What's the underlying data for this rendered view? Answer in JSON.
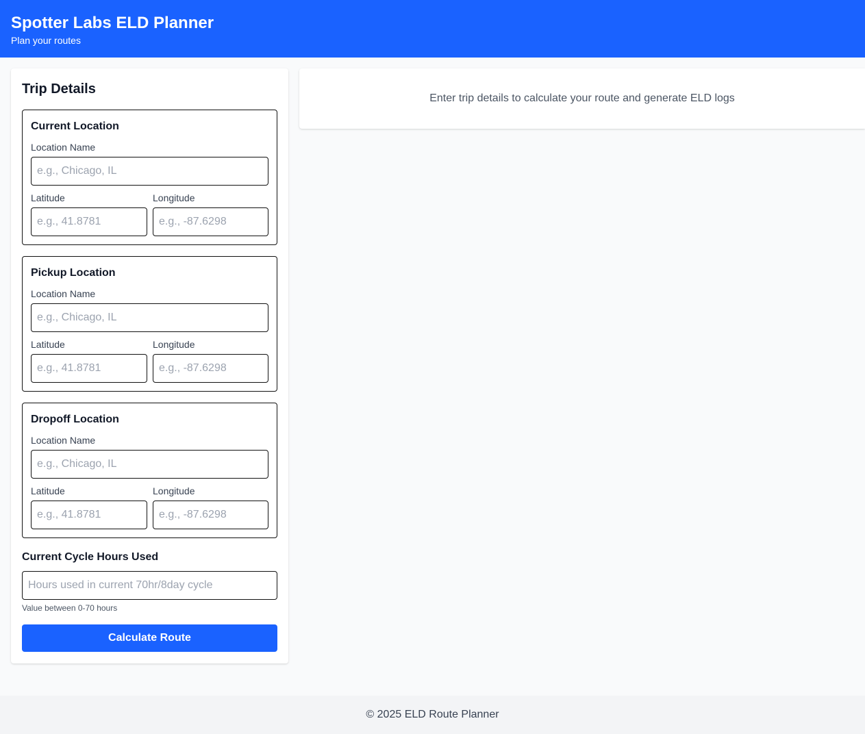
{
  "header": {
    "title": "Spotter Labs ELD Planner",
    "subtitle": "Plan your routes"
  },
  "form": {
    "title": "Trip Details",
    "sections": [
      {
        "title": "Current Location",
        "name_label": "Location Name",
        "name_placeholder": "e.g., Chicago, IL",
        "lat_label": "Latitude",
        "lat_placeholder": "e.g., 41.8781",
        "lng_label": "Longitude",
        "lng_placeholder": "e.g., -87.6298"
      },
      {
        "title": "Pickup Location",
        "name_label": "Location Name",
        "name_placeholder": "e.g., Chicago, IL",
        "lat_label": "Latitude",
        "lat_placeholder": "e.g., 41.8781",
        "lng_label": "Longitude",
        "lng_placeholder": "e.g., -87.6298"
      },
      {
        "title": "Dropoff Location",
        "name_label": "Location Name",
        "name_placeholder": "e.g., Chicago, IL",
        "lat_label": "Latitude",
        "lat_placeholder": "e.g., 41.8781",
        "lng_label": "Longitude",
        "lng_placeholder": "e.g., -87.6298"
      }
    ],
    "hours_label": "Current Cycle Hours Used",
    "hours_placeholder": "Hours used in current 70hr/8day cycle",
    "hours_hint": "Value between 0-70 hours",
    "submit_label": "Calculate Route"
  },
  "results": {
    "empty_message": "Enter trip details to calculate your route and generate ELD logs"
  },
  "footer": {
    "text": "© 2025 ELD Route Planner"
  },
  "colors": {
    "primary": "#1a62ff",
    "background": "#f9fafb",
    "footer_bg": "#f3f4f6"
  }
}
